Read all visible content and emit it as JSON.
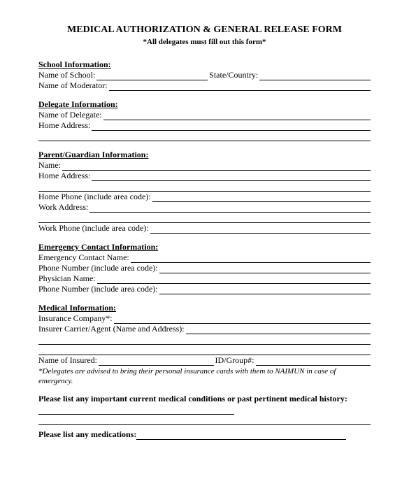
{
  "title": "MEDICAL AUTHORIZATION & GENERAL RELEASE FORM",
  "subtitle": "*All delegates must fill out this form*",
  "school": {
    "header": "School Information:",
    "name_label": "Name of School:",
    "state_label": "State/Country:",
    "moderator_label": "Name of Moderator:"
  },
  "delegate": {
    "header": "Delegate Information:",
    "name_label": "Name of Delegate:",
    "address_label": "Home Address:"
  },
  "parent": {
    "header": "Parent/Guardian Information:",
    "name_label": "Name:",
    "address_label": "Home Address:",
    "home_phone_label": "Home Phone (include area code):",
    "work_address_label": "Work Address:",
    "work_phone_label": "Work Phone (include area code):"
  },
  "emergency": {
    "header": "Emergency Contact Information:",
    "name_label": "Emergency Contact Name:",
    "phone1_label": "Phone Number (include area code):",
    "physician_label": "Physician Name:",
    "phone2_label": "Phone Number (include area code):"
  },
  "medical": {
    "header": "Medical Information:",
    "insurance_label": "Insurance Company*:",
    "carrier_label": "Insurer Carrier/Agent (Name and Address):",
    "insured_label": "Name of Insured:",
    "group_label": "ID/Group#:",
    "note": "*Delegates are advised to bring their personal insurance cards with them to NAIMUN in case of emergency."
  },
  "conditions_label": "Please list any important current medical conditions or past pertinent medical history:",
  "medications_label": "Please list any medications:"
}
